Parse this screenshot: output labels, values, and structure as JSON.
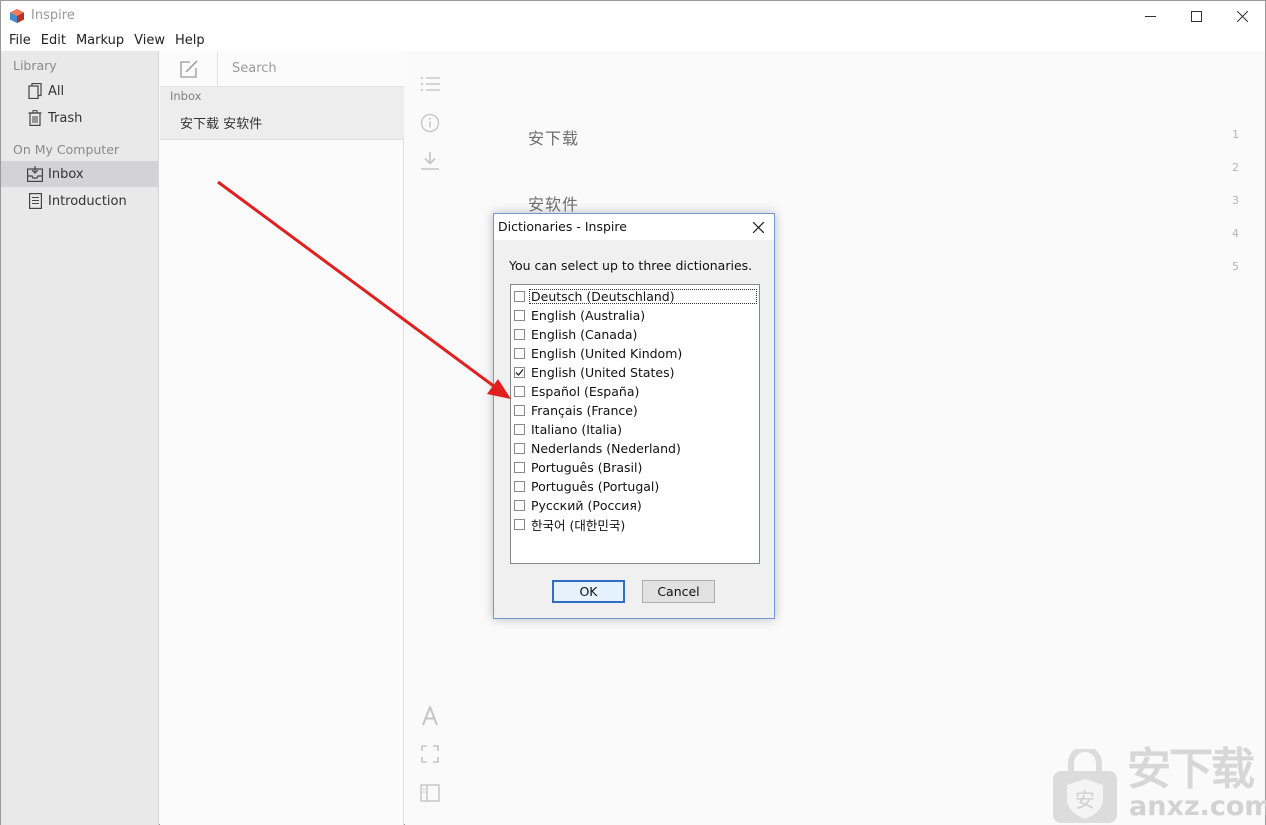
{
  "window": {
    "title": "Inspire",
    "minimize_glyph": "—",
    "maximize_glyph": "☐",
    "close_glyph": "✕"
  },
  "menubar": {
    "items": [
      "File",
      "Edit",
      "Markup",
      "View",
      "Help"
    ]
  },
  "sidebar": {
    "library_label": "Library",
    "library_items": [
      {
        "label": "All",
        "icon": "documents-icon"
      },
      {
        "label": "Trash",
        "icon": "trash-icon"
      }
    ],
    "computer_label": "On My Computer",
    "computer_items": [
      {
        "label": "Inbox",
        "icon": "inbox-icon",
        "selected": true
      },
      {
        "label": "Introduction",
        "icon": "document-icon",
        "selected": false
      }
    ]
  },
  "note_list": {
    "search_placeholder": "Search",
    "group_header": "Inbox",
    "notes": [
      "安下载 安软件"
    ]
  },
  "editor": {
    "lines": [
      "安下载",
      "",
      "安软件",
      "",
      ""
    ],
    "line_numbers": [
      "1",
      "2",
      "3",
      "4",
      "5"
    ]
  },
  "dialog": {
    "title": "Dictionaries - Inspire",
    "prompt": "You can select up to three dictionaries.",
    "dictionaries": [
      {
        "label": "Deutsch (Deutschland)",
        "checked": false
      },
      {
        "label": "English (Australia)",
        "checked": false
      },
      {
        "label": "English (Canada)",
        "checked": false
      },
      {
        "label": "English (United Kindom)",
        "checked": false
      },
      {
        "label": "English (United States)",
        "checked": true
      },
      {
        "label": "Español (España)",
        "checked": false
      },
      {
        "label": "Français (France)",
        "checked": false
      },
      {
        "label": "Italiano (Italia)",
        "checked": false
      },
      {
        "label": "Nederlands (Nederland)",
        "checked": false
      },
      {
        "label": "Português (Brasil)",
        "checked": false
      },
      {
        "label": "Português (Portugal)",
        "checked": false
      },
      {
        "label": "Русский (Россия)",
        "checked": false
      },
      {
        "label": "한국어 (대한민국)",
        "checked": false
      }
    ],
    "ok_label": "OK",
    "cancel_label": "Cancel",
    "close_glyph": "✕"
  },
  "watermark": {
    "text": "安下载",
    "url": "anxz.com",
    "shield_glyph": "安"
  },
  "colors": {
    "accent": "#2f6ec6",
    "arrow": "#e02020",
    "sidebar_bg": "#e9e9ea",
    "selected_bg": "#d3d3d5"
  }
}
